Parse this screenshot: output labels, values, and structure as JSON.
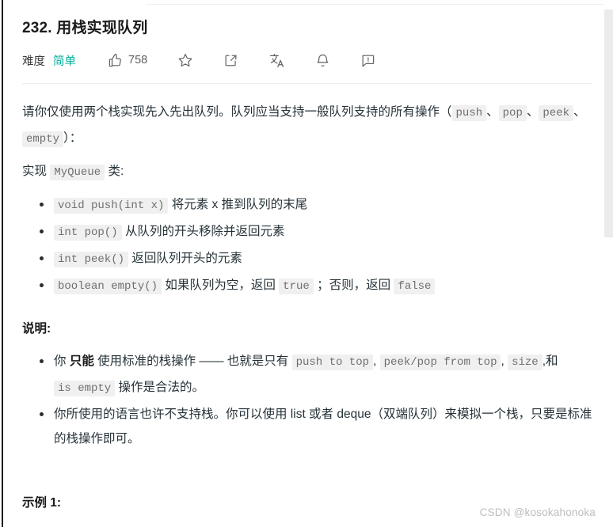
{
  "problem": {
    "title": "232. 用栈实现队列",
    "difficulty_label": "难度",
    "difficulty_value": "简单",
    "difficulty_color": "#00af9b",
    "like_count": "758"
  },
  "actions": {
    "like": "thumbs-up-icon",
    "favorite": "star-icon",
    "share": "share-icon",
    "translate": "translate-icon",
    "subscribe": "bell-icon",
    "comment": "comment-icon"
  },
  "description": {
    "intro_part1": "请你仅使用两个栈实现先入先出队列。队列应当支持一般队列支持的所有操作",
    "intro_paren_open": "（",
    "intro_code1": "push",
    "intro_sep1": "、",
    "intro_code2": "pop",
    "intro_sep2": "、",
    "intro_code3": "peek",
    "intro_sep3": "、",
    "intro_code4": "empty",
    "intro_paren_close": "）：",
    "implement_prefix": "实现",
    "implement_class": "MyQueue",
    "implement_suffix": "类:",
    "methods": [
      {
        "code": "void push(int x)",
        "text": "将元素 x 推到队列的末尾"
      },
      {
        "code": "int pop()",
        "text": "从队列的开头移除并返回元素"
      },
      {
        "code": "int peek()",
        "text": "返回队列开头的元素"
      }
    ],
    "method_empty": {
      "code": "boolean empty()",
      "text_before": "如果队列为空，返回",
      "code_true": "true",
      "text_middle": "；否则，返回",
      "code_false": "false"
    }
  },
  "notes": {
    "heading": "说明:",
    "item1": {
      "t1": "你",
      "bold": "只能",
      "t2": "使用标准的栈操作 —— 也就是只有",
      "c1": "push to top",
      "s1": ",",
      "c2": "peek/pop from top",
      "s2": ",",
      "c3": "size",
      "s3": ",和",
      "c4": "is empty",
      "t3": "操作是合法的。"
    },
    "item2": "你所使用的语言也许不支持栈。你可以使用 list 或者 deque（双端队列）来模拟一个栈，只要是标准的栈操作即可。"
  },
  "example": {
    "heading": "示例 1:"
  },
  "watermark": "CSDN @kosokahonoka"
}
